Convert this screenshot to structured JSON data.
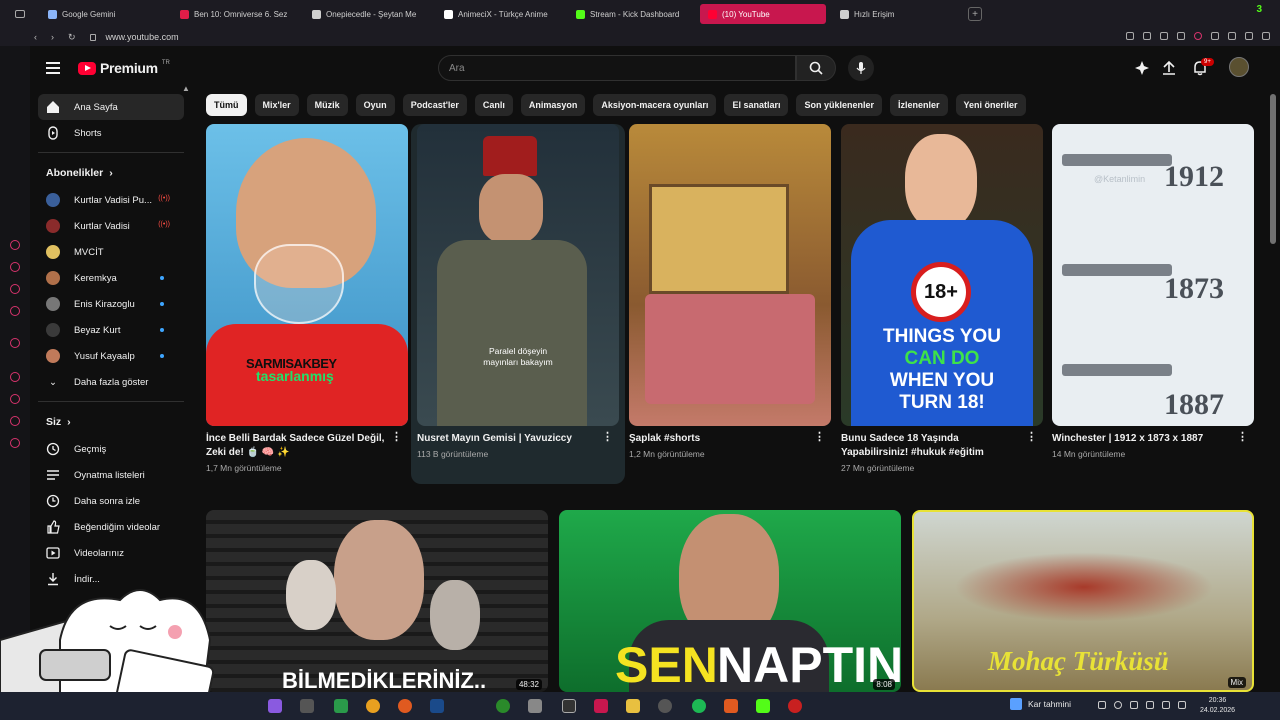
{
  "browser": {
    "tabs": [
      {
        "label": "Google Gemini",
        "color": "#8ab4f8"
      },
      {
        "label": "Ben 10: Omniverse 6. Sez",
        "color": "#e11d48"
      },
      {
        "label": "Onepiecedle - Şeytan Me",
        "color": "#cfcfcf"
      },
      {
        "label": "AnimeciX - Türkçe Anime",
        "color": "#ffffff"
      },
      {
        "label": "Stream - Kick Dashboard",
        "color": "#53fc18"
      },
      {
        "label": "(10) YouTube",
        "color": "#ff0033"
      },
      {
        "label": "Hızlı Erişim",
        "color": "#cfcfcf"
      }
    ],
    "url": "www.youtube.com",
    "badge": "3"
  },
  "youtube": {
    "logo_text": "Premium",
    "logo_region": "TR",
    "search_placeholder": "Ara",
    "notif_count": "9+",
    "sidebar": {
      "main": [
        {
          "label": "Ana Sayfa",
          "icon": "home-icon"
        },
        {
          "label": "Shorts",
          "icon": "shorts-icon"
        }
      ],
      "subs_title": "Abonelikler",
      "subs": [
        {
          "label": "Kurtlar Vadisi Pu...",
          "color": "#3a5f9a",
          "status": "live"
        },
        {
          "label": "Kurtlar Vadisi",
          "color": "#8a2b2b",
          "status": "live"
        },
        {
          "label": "MVCİT",
          "color": "#e0c060",
          "status": "none"
        },
        {
          "label": "Keremkya",
          "color": "#b0704a",
          "status": "dot"
        },
        {
          "label": "Enis Kirazoglu",
          "color": "#777777",
          "status": "dot"
        },
        {
          "label": "Beyaz Kurt",
          "color": "#3a3a3a",
          "status": "dot"
        },
        {
          "label": "Yusuf Kayaalp",
          "color": "#c07a5a",
          "status": "dot"
        }
      ],
      "more": "Daha fazla göster",
      "you_title": "Siz",
      "you": [
        {
          "label": "Geçmiş",
          "icon": "history-icon"
        },
        {
          "label": "Oynatma listeleri",
          "icon": "playlist-icon"
        },
        {
          "label": "Daha sonra izle",
          "icon": "clock-icon"
        },
        {
          "label": "Beğendiğim videolar",
          "icon": "like-icon"
        },
        {
          "label": "Videolarınız",
          "icon": "video-icon"
        },
        {
          "label": "İndir...",
          "icon": "download-icon"
        }
      ]
    },
    "chips": [
      "Tümü",
      "Mix'ler",
      "Müzik",
      "Oyun",
      "Podcast'ler",
      "Canlı",
      "Animasyon",
      "Aksiyon-macera oyunları",
      "El sanatları",
      "Son yüklenenler",
      "İzlenenler",
      "Yeni öneriler"
    ],
    "shorts": [
      {
        "title": "İnce Belli Bardak Sadece Güzel Değil, Zeki de! 🍵 🧠 ✨",
        "views": "1,7 Mn görüntüleme",
        "caption": "tasarlanmış",
        "shirt": "SARMISAKBEY"
      },
      {
        "title": "Nusret Mayın Gemisi | Yavuziccy",
        "views": "113 B görüntüleme",
        "caption": "Paralel döşeyin mayınları bakayım"
      },
      {
        "title": "Şaplak #shorts",
        "views": "1,2 Mn görüntüleme"
      },
      {
        "title": "Bunu Sadece 18 Yaşında Yapabilirsiniz! #hukuk #eğitim",
        "views": "27 Mn görüntüleme",
        "badge": "18+",
        "line1": "THINGS YOU",
        "line2": "CAN DO",
        "line3": "WHEN YOU",
        "line4": "TURN 18!"
      },
      {
        "title": "Winchester | 1912 x 1873 x 1887",
        "views": "14 Mn görüntüleme",
        "y1": "1912",
        "y2": "1873",
        "y3": "1887",
        "handle": "@Ketanlimin"
      }
    ],
    "videos": [
      {
        "overlay": "BİLMEDİKLERİNİZ..",
        "duration": "48:32"
      },
      {
        "overlay_a": "SEN",
        "overlay_b": "NAPTIN?",
        "duration": "8:08"
      },
      {
        "overlay": "Mohaç Türküsü",
        "tag": "Mix"
      }
    ]
  },
  "taskbar": {
    "weather": "Kar tahmini",
    "time": "20:36",
    "date": "24.02.2026"
  }
}
